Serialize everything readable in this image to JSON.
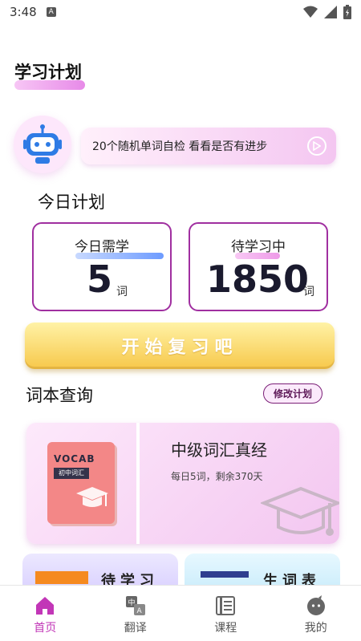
{
  "status": {
    "time": "3:48",
    "notif_letter": "A"
  },
  "header": {
    "title": "学习计划"
  },
  "banner": {
    "text": "20个随机单词自检  看看是否有进步"
  },
  "plan": {
    "title": "今日计划",
    "today": {
      "label": "今日需学",
      "value": "5",
      "unit": "词"
    },
    "pending": {
      "label": "待学习中",
      "value": "1850",
      "unit": "词"
    }
  },
  "start_button": "开始复习吧",
  "lookup": {
    "title": "词本查询",
    "modify_label": "修改计划"
  },
  "book": {
    "cover_word": "VOCAB",
    "cover_level": "初中词汇",
    "title": "中级词汇真经",
    "subtitle": "每日5词，剩余370天"
  },
  "bottom_cards": [
    {
      "label": "待学习"
    },
    {
      "label": "生词表"
    }
  ],
  "tabs": [
    {
      "label": "首页",
      "icon": "home-icon",
      "active": true
    },
    {
      "label": "翻译",
      "icon": "translate-icon",
      "active": false
    },
    {
      "label": "课程",
      "icon": "course-icon",
      "active": false
    },
    {
      "label": "我的",
      "icon": "profile-icon",
      "active": false
    }
  ],
  "colors": {
    "accent": "#c236b7",
    "card_border": "#a02fa0",
    "button": "#f7c84a"
  }
}
